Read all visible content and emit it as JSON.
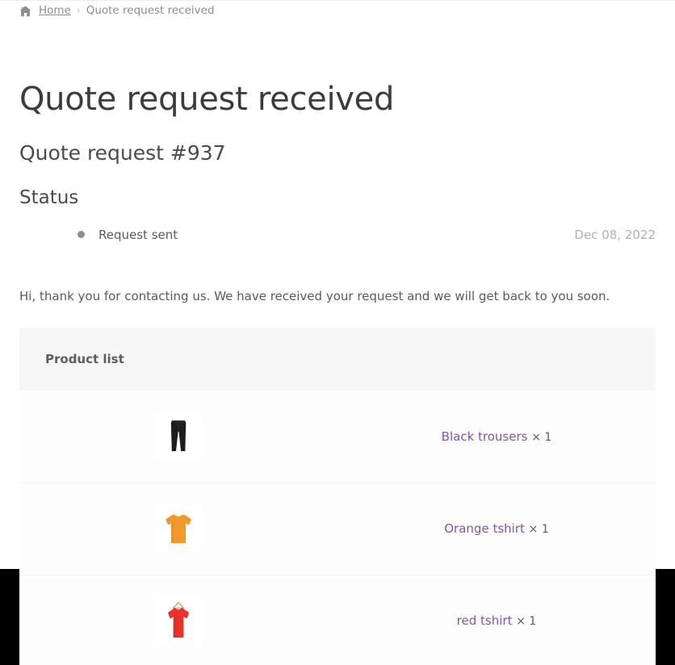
{
  "breadcrumb": {
    "home_icon": "home-icon",
    "home_label": "Home",
    "separator": "›",
    "current": "Quote request received"
  },
  "header": {
    "title": "Quote request received",
    "order_number": "Quote request #937"
  },
  "status": {
    "heading": "Status",
    "entries": [
      {
        "label": "Request sent",
        "date": "Dec 08, 2022",
        "dot_color": "#8f8f8f"
      }
    ]
  },
  "message": "Hi, thank you for contacting us. We have received your request and we will get back to you soon.",
  "product_list": {
    "header": "Product list",
    "items": [
      {
        "name": "Black trousers",
        "qty": "× 1",
        "image": "black-trousers-thumbnail"
      },
      {
        "name": "Orange tshirt",
        "qty": "× 1",
        "image": "orange-tshirt-thumbnail"
      },
      {
        "name": "red tshirt",
        "qty": "× 1",
        "image": "red-tshirt-thumbnail"
      }
    ]
  },
  "colors": {
    "link": "#7f54b3",
    "text": "#5a5a5a",
    "muted": "#b0b0b0",
    "table_header_bg": "#f6f6f6",
    "page_backdrop": "#000000"
  }
}
